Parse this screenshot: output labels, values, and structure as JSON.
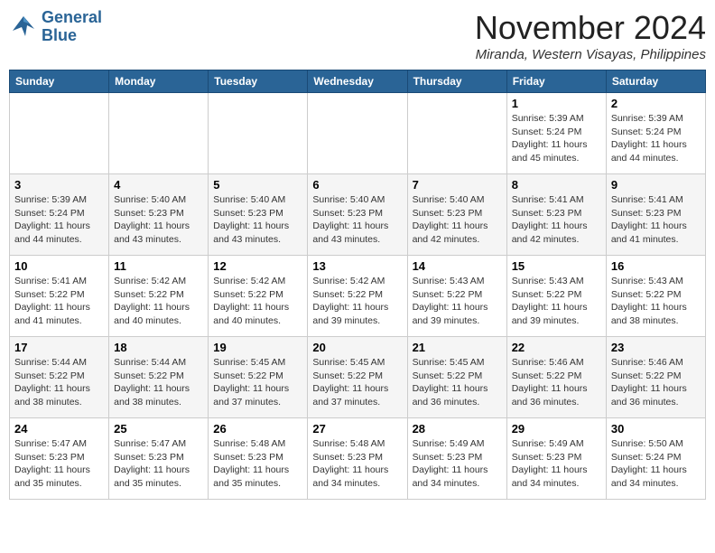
{
  "logo": {
    "line1": "General",
    "line2": "Blue"
  },
  "title": "November 2024",
  "location": "Miranda, Western Visayas, Philippines",
  "header_days": [
    "Sunday",
    "Monday",
    "Tuesday",
    "Wednesday",
    "Thursday",
    "Friday",
    "Saturday"
  ],
  "weeks": [
    [
      {
        "day": "",
        "info": ""
      },
      {
        "day": "",
        "info": ""
      },
      {
        "day": "",
        "info": ""
      },
      {
        "day": "",
        "info": ""
      },
      {
        "day": "",
        "info": ""
      },
      {
        "day": "1",
        "info": "Sunrise: 5:39 AM\nSunset: 5:24 PM\nDaylight: 11 hours\nand 45 minutes."
      },
      {
        "day": "2",
        "info": "Sunrise: 5:39 AM\nSunset: 5:24 PM\nDaylight: 11 hours\nand 44 minutes."
      }
    ],
    [
      {
        "day": "3",
        "info": "Sunrise: 5:39 AM\nSunset: 5:24 PM\nDaylight: 11 hours\nand 44 minutes."
      },
      {
        "day": "4",
        "info": "Sunrise: 5:40 AM\nSunset: 5:23 PM\nDaylight: 11 hours\nand 43 minutes."
      },
      {
        "day": "5",
        "info": "Sunrise: 5:40 AM\nSunset: 5:23 PM\nDaylight: 11 hours\nand 43 minutes."
      },
      {
        "day": "6",
        "info": "Sunrise: 5:40 AM\nSunset: 5:23 PM\nDaylight: 11 hours\nand 43 minutes."
      },
      {
        "day": "7",
        "info": "Sunrise: 5:40 AM\nSunset: 5:23 PM\nDaylight: 11 hours\nand 42 minutes."
      },
      {
        "day": "8",
        "info": "Sunrise: 5:41 AM\nSunset: 5:23 PM\nDaylight: 11 hours\nand 42 minutes."
      },
      {
        "day": "9",
        "info": "Sunrise: 5:41 AM\nSunset: 5:23 PM\nDaylight: 11 hours\nand 41 minutes."
      }
    ],
    [
      {
        "day": "10",
        "info": "Sunrise: 5:41 AM\nSunset: 5:22 PM\nDaylight: 11 hours\nand 41 minutes."
      },
      {
        "day": "11",
        "info": "Sunrise: 5:42 AM\nSunset: 5:22 PM\nDaylight: 11 hours\nand 40 minutes."
      },
      {
        "day": "12",
        "info": "Sunrise: 5:42 AM\nSunset: 5:22 PM\nDaylight: 11 hours\nand 40 minutes."
      },
      {
        "day": "13",
        "info": "Sunrise: 5:42 AM\nSunset: 5:22 PM\nDaylight: 11 hours\nand 39 minutes."
      },
      {
        "day": "14",
        "info": "Sunrise: 5:43 AM\nSunset: 5:22 PM\nDaylight: 11 hours\nand 39 minutes."
      },
      {
        "day": "15",
        "info": "Sunrise: 5:43 AM\nSunset: 5:22 PM\nDaylight: 11 hours\nand 39 minutes."
      },
      {
        "day": "16",
        "info": "Sunrise: 5:43 AM\nSunset: 5:22 PM\nDaylight: 11 hours\nand 38 minutes."
      }
    ],
    [
      {
        "day": "17",
        "info": "Sunrise: 5:44 AM\nSunset: 5:22 PM\nDaylight: 11 hours\nand 38 minutes."
      },
      {
        "day": "18",
        "info": "Sunrise: 5:44 AM\nSunset: 5:22 PM\nDaylight: 11 hours\nand 38 minutes."
      },
      {
        "day": "19",
        "info": "Sunrise: 5:45 AM\nSunset: 5:22 PM\nDaylight: 11 hours\nand 37 minutes."
      },
      {
        "day": "20",
        "info": "Sunrise: 5:45 AM\nSunset: 5:22 PM\nDaylight: 11 hours\nand 37 minutes."
      },
      {
        "day": "21",
        "info": "Sunrise: 5:45 AM\nSunset: 5:22 PM\nDaylight: 11 hours\nand 36 minutes."
      },
      {
        "day": "22",
        "info": "Sunrise: 5:46 AM\nSunset: 5:22 PM\nDaylight: 11 hours\nand 36 minutes."
      },
      {
        "day": "23",
        "info": "Sunrise: 5:46 AM\nSunset: 5:22 PM\nDaylight: 11 hours\nand 36 minutes."
      }
    ],
    [
      {
        "day": "24",
        "info": "Sunrise: 5:47 AM\nSunset: 5:23 PM\nDaylight: 11 hours\nand 35 minutes."
      },
      {
        "day": "25",
        "info": "Sunrise: 5:47 AM\nSunset: 5:23 PM\nDaylight: 11 hours\nand 35 minutes."
      },
      {
        "day": "26",
        "info": "Sunrise: 5:48 AM\nSunset: 5:23 PM\nDaylight: 11 hours\nand 35 minutes."
      },
      {
        "day": "27",
        "info": "Sunrise: 5:48 AM\nSunset: 5:23 PM\nDaylight: 11 hours\nand 34 minutes."
      },
      {
        "day": "28",
        "info": "Sunrise: 5:49 AM\nSunset: 5:23 PM\nDaylight: 11 hours\nand 34 minutes."
      },
      {
        "day": "29",
        "info": "Sunrise: 5:49 AM\nSunset: 5:23 PM\nDaylight: 11 hours\nand 34 minutes."
      },
      {
        "day": "30",
        "info": "Sunrise: 5:50 AM\nSunset: 5:24 PM\nDaylight: 11 hours\nand 34 minutes."
      }
    ]
  ]
}
